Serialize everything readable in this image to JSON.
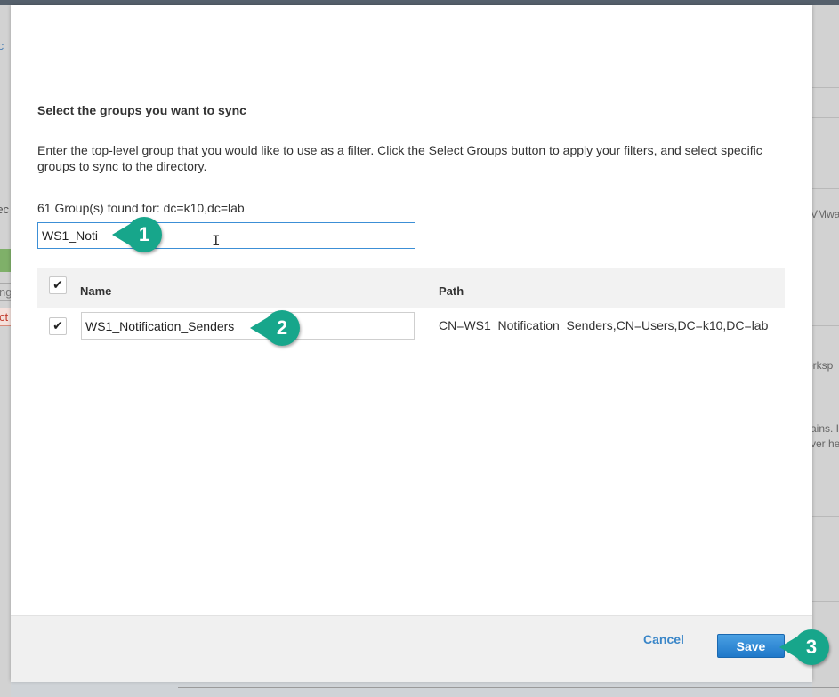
{
  "background": {
    "left_fragments": [
      "tc",
      "rec",
      "ng",
      "ct"
    ],
    "right_fragments": [
      "VMwa",
      "orksp",
      "ains. I",
      "ver he"
    ]
  },
  "dialog": {
    "heading": "Select the groups you want to sync",
    "description": "Enter the top-level group that you would like to use as a filter. Click the Select Groups button to apply your filters, and select specific groups to sync to the directory.",
    "found_text": "61 Group(s) found for: dc=k10,dc=lab",
    "filter_value": "WS1_Noti",
    "table": {
      "columns": [
        "Name",
        "Path"
      ],
      "rows": [
        {
          "checked": true,
          "name": "WS1_Notification_Senders",
          "path": "CN=WS1_Notification_Senders,CN=Users,DC=k10,DC=lab"
        }
      ]
    },
    "footer": {
      "cancel_label": "Cancel",
      "save_label": "Save"
    }
  },
  "callouts": [
    "1",
    "2",
    "3"
  ],
  "colors": {
    "accent": "#3c8fd6",
    "callout": "#17a68b",
    "save_button": "#1f78c9"
  },
  "icons": {
    "checkmark": "check-icon",
    "text_cursor": "ibeam-cursor-icon"
  }
}
